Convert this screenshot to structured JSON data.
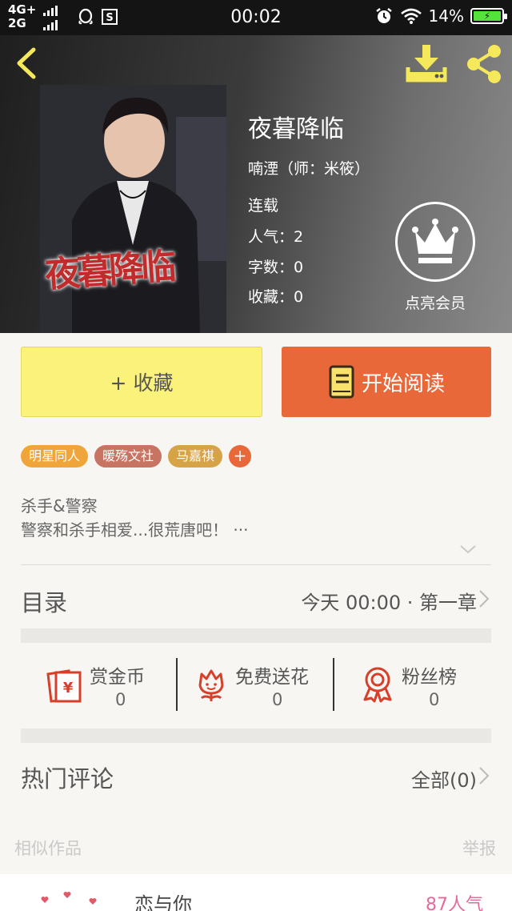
{
  "status_bar": {
    "network_top": "4G+",
    "network_bottom": "2G",
    "time": "00:02",
    "battery": "14%",
    "icons": [
      "signal-icon",
      "qq-icon",
      "notification-s-icon",
      "alarm-icon",
      "wifi-icon",
      "battery-icon"
    ]
  },
  "book": {
    "cover_title": "夜暮降临",
    "title": "夜暮降临",
    "author": "喃湮（师：米筱）",
    "status": "连载",
    "popularity": "人气：2",
    "words": "字数：0",
    "favorites": "收藏：0",
    "vip_label": "点亮会员"
  },
  "actions": {
    "favorite": "+ 收藏",
    "read": "开始阅读"
  },
  "tags": [
    {
      "label": "明星同人",
      "color": "#f0a53a"
    },
    {
      "label": "暖殇文社",
      "color": "#c87462"
    },
    {
      "label": "马嘉祺",
      "color": "#d6a347"
    }
  ],
  "tag_add": "+",
  "description": {
    "line1": "杀手&警察",
    "line2": "警察和杀手相爱...很荒唐吧！ ···"
  },
  "catalog": {
    "title": "目录",
    "latest": "今天 00:00 · 第一章"
  },
  "features": [
    {
      "label": "赏金币",
      "value": "0",
      "icon": "bounty-coin-icon"
    },
    {
      "label": "免费送花",
      "value": "0",
      "icon": "flower-icon"
    },
    {
      "label": "粉丝榜",
      "value": "0",
      "icon": "ribbon-medal-icon"
    }
  ],
  "comments": {
    "title": "热门评论",
    "all": "全部(0)"
  },
  "similar": {
    "title": "相似作品",
    "report": "举报",
    "items": [
      {
        "title": "恋与你",
        "popularity": "87人气"
      }
    ]
  },
  "colors": {
    "accent_orange": "#e9683a",
    "favorite_yellow": "#faf27a",
    "pink": "#e56a9b",
    "icon_red": "#d6402b",
    "header_icon_yellow": "#f5e85a"
  }
}
